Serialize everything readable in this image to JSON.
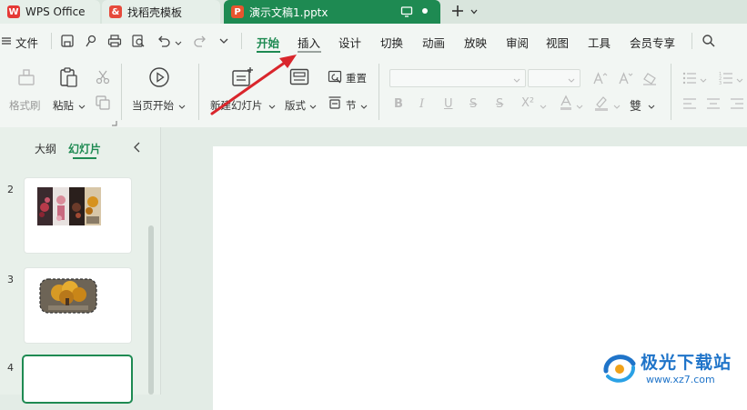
{
  "tabs": [
    {
      "label": "WPS Office"
    },
    {
      "label": "找稻壳模板"
    },
    {
      "label": "演示文稿1.pptx"
    }
  ],
  "tab_icons": {
    "wps": "W",
    "docer": "&",
    "ppt": "P"
  },
  "menu": {
    "hamburger_label": "文件",
    "items": [
      "开始",
      "插入",
      "设计",
      "切换",
      "动画",
      "放映",
      "审阅",
      "视图",
      "工具",
      "会员专享"
    ],
    "active": "开始"
  },
  "ribbon": {
    "format_painter": "格式刷",
    "paste": "粘贴",
    "from_current": "当页开始",
    "new_slide": "新建幻灯片",
    "layout": "版式",
    "reset": "重置",
    "section": "节"
  },
  "panel": {
    "outline_tab": "大纲",
    "slides_tab": "幻灯片",
    "slide_numbers": [
      "2",
      "3",
      "4"
    ]
  },
  "watermark": {
    "name": "极光下载站",
    "url": "www.xz7.com"
  },
  "colors": {
    "accent": "#1e8a52",
    "arrow": "#d9262c"
  }
}
